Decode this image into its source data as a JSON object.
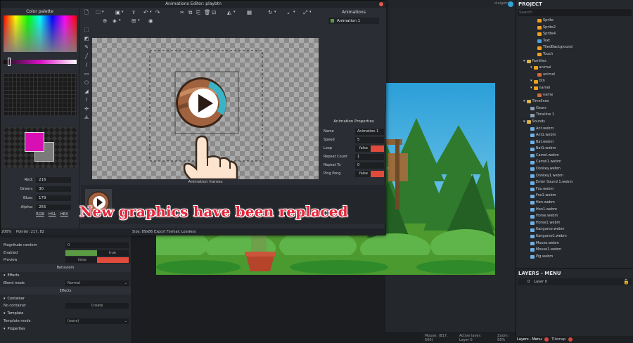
{
  "dialog": {
    "title": "Animations Editor: playbtn",
    "palette_title": "Color palette",
    "rgba": [
      {
        "label": "Red:",
        "value": "216"
      },
      {
        "label": "Green:",
        "value": "30"
      },
      {
        "label": "Blue:",
        "value": "179"
      },
      {
        "label": "Alpha:",
        "value": "255"
      }
    ],
    "color_modes": [
      "RGB",
      "HSL",
      "HEX"
    ],
    "primary_color": "#d810b3",
    "secondary_color": "#7a7a7a",
    "animations_title": "Animations",
    "animation_item": "Animation 1",
    "anim_props_title": "Animation Properties",
    "anim_props": [
      {
        "label": "Name",
        "value": "Animation 1"
      },
      {
        "label": "Speed",
        "value": "5"
      },
      {
        "label": "Loop",
        "value": "false"
      },
      {
        "label": "Repeat Count",
        "value": "1"
      },
      {
        "label": "Repeat To",
        "value": "0"
      },
      {
        "label": "Ping Pong",
        "value": "false"
      }
    ],
    "frames_label": "Animation frames",
    "status": {
      "zoom": "200%",
      "pointer": "Pointer: 217, 82",
      "size": "Size: 89x86",
      "export": "Export Format: Lossless"
    }
  },
  "caption": "New graphics have been replaced",
  "project": {
    "title": "PROJECT",
    "search_placeholder": "Search",
    "tree": [
      {
        "label": "Sprite",
        "indent": 3,
        "kind": "obj"
      },
      {
        "label": "Sprite2",
        "indent": 3,
        "kind": "obj"
      },
      {
        "label": "Sprite4",
        "indent": 3,
        "kind": "obj"
      },
      {
        "label": "Text",
        "indent": 3,
        "kind": "text"
      },
      {
        "label": "TiledBackground",
        "indent": 3,
        "kind": "obj"
      },
      {
        "label": "Touch",
        "indent": 3,
        "kind": "obj"
      },
      {
        "label": "Families",
        "indent": 1,
        "kind": "folder"
      },
      {
        "label": "animal",
        "indent": 2,
        "kind": "obj"
      },
      {
        "label": "animal",
        "indent": 3,
        "kind": "img"
      },
      {
        "label": "btn",
        "indent": 2,
        "kind": "obj"
      },
      {
        "label": "namel",
        "indent": 2,
        "kind": "obj"
      },
      {
        "label": "name",
        "indent": 3,
        "kind": "img"
      },
      {
        "label": "Timelines",
        "indent": 1,
        "kind": "folder"
      },
      {
        "label": "Gears",
        "indent": 2,
        "kind": "file"
      },
      {
        "label": "Timeline 1",
        "indent": 2,
        "kind": "file"
      },
      {
        "label": "Sounds",
        "indent": 1,
        "kind": "folder"
      },
      {
        "label": "Ant.webm",
        "indent": 2,
        "kind": "sound"
      },
      {
        "label": "Ant1.webm",
        "indent": 2,
        "kind": "sound"
      },
      {
        "label": "Bat.webm",
        "indent": 2,
        "kind": "sound"
      },
      {
        "label": "Bat1.webm",
        "indent": 2,
        "kind": "sound"
      },
      {
        "label": "Camel.webm",
        "indent": 2,
        "kind": "sound"
      },
      {
        "label": "Camel1.webm",
        "indent": 2,
        "kind": "sound"
      },
      {
        "label": "Donkey.webm",
        "indent": 2,
        "kind": "sound"
      },
      {
        "label": "Donkey1.webm",
        "indent": 2,
        "kind": "sound"
      },
      {
        "label": "Enter Sound 1.webm",
        "indent": 2,
        "kind": "sound"
      },
      {
        "label": "Fox.webm",
        "indent": 2,
        "kind": "sound"
      },
      {
        "label": "Fox1.webm",
        "indent": 2,
        "kind": "sound"
      },
      {
        "label": "Hen.webm",
        "indent": 2,
        "kind": "sound"
      },
      {
        "label": "Hen1.webm",
        "indent": 2,
        "kind": "sound"
      },
      {
        "label": "Horse.webm",
        "indent": 2,
        "kind": "sound"
      },
      {
        "label": "Horse1.webm",
        "indent": 2,
        "kind": "sound"
      },
      {
        "label": "Kangaroo.webm",
        "indent": 2,
        "kind": "sound"
      },
      {
        "label": "Kangaroo1.webm",
        "indent": 2,
        "kind": "sound"
      },
      {
        "label": "Mouse.webm",
        "indent": 2,
        "kind": "sound"
      },
      {
        "label": "Mouse1.webm",
        "indent": 2,
        "kind": "sound"
      },
      {
        "label": "Pig.webm",
        "indent": 2,
        "kind": "sound"
      }
    ]
  },
  "layers": {
    "title": "LAYERS - MENU",
    "rows": [
      {
        "index": "0",
        "name": "Layer 0"
      }
    ]
  },
  "bottom_tabs": [
    "Layers - Menu",
    "Tilemap"
  ],
  "statusbar": {
    "mouse": "Mouse: (817, 500)",
    "active_layer": "Active layer: Layer 0",
    "zoom": "Zoom: 85%"
  },
  "topbar_user": "olelgetn",
  "properties": {
    "rows": [
      {
        "label": "Magnitude random",
        "value": "0",
        "type": "field"
      },
      {
        "label": "Enabled",
        "value": "true",
        "type": "green"
      },
      {
        "label": "Preview",
        "value": "false",
        "type": "red"
      }
    ],
    "behaviors": "Behaviors",
    "effects_group": "Effects",
    "blend_label": "Blend mode",
    "blend_value": "Normal",
    "effects_header": "Effects",
    "container_group": "Container",
    "no_container": "No container",
    "create": "Create",
    "template_group": "Template",
    "template_mode": "Template mode",
    "template_value": "(none)",
    "properties_group": "Properties"
  },
  "colors": {
    "accent_red": "#e04b3b",
    "green": "#5a9b44",
    "magenta": "#d810b3"
  }
}
